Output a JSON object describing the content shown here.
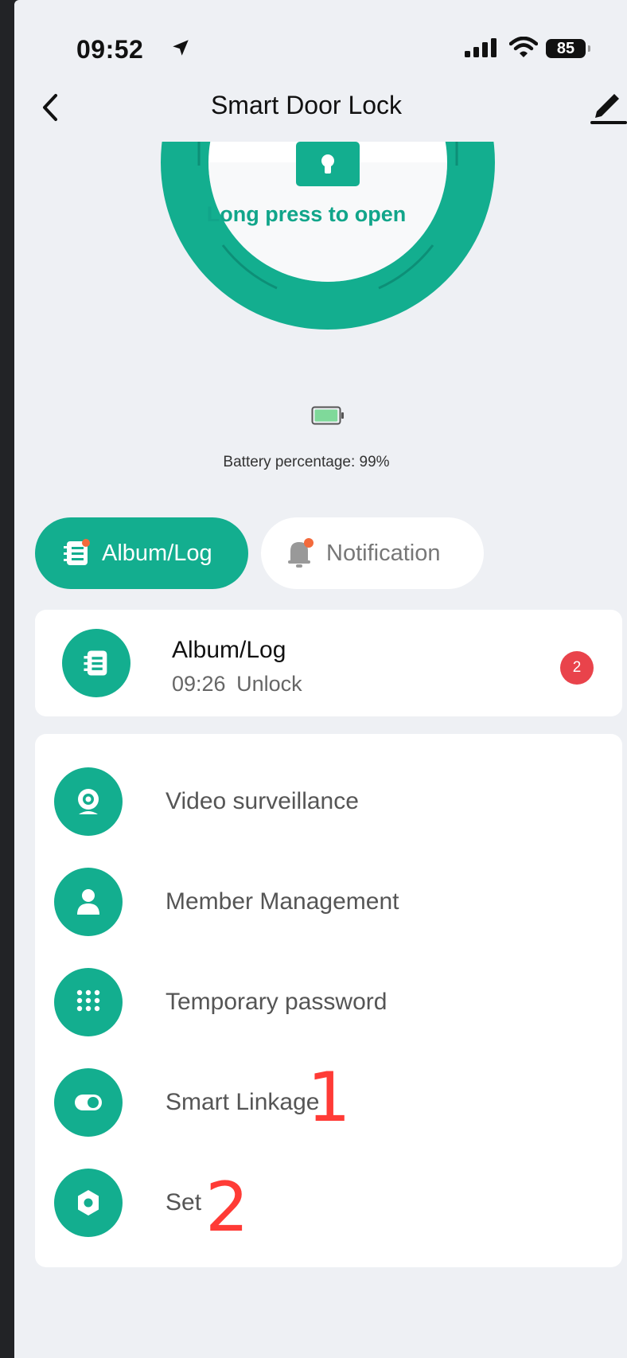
{
  "status_bar": {
    "time": "09:52",
    "battery_level": "85"
  },
  "nav": {
    "title": "Smart Door Lock"
  },
  "lock": {
    "press_label": "Long press to open"
  },
  "battery": {
    "text": "Battery percentage: 99%",
    "level_fraction": 0.99
  },
  "tabs": [
    {
      "label": "Album/Log",
      "active": true
    },
    {
      "label": "Notification",
      "active": false
    }
  ],
  "log_card": {
    "title": "Album/Log",
    "subtitle": "09:26  Unlock",
    "badge_count": "2"
  },
  "menu": [
    {
      "label": "Video surveillance",
      "icon": "camera-icon"
    },
    {
      "label": "Member Management",
      "icon": "person-icon"
    },
    {
      "label": "Temporary password",
      "icon": "keypad-icon"
    },
    {
      "label": "Smart Linkage",
      "icon": "toggle-icon"
    },
    {
      "label": "Set",
      "icon": "gear-icon"
    }
  ],
  "annotations": [
    "1",
    "2"
  ],
  "colors": {
    "accent": "#13ae8f",
    "badge": "#e9434b",
    "annotation": "#ff3b36",
    "background": "#eef0f4"
  }
}
